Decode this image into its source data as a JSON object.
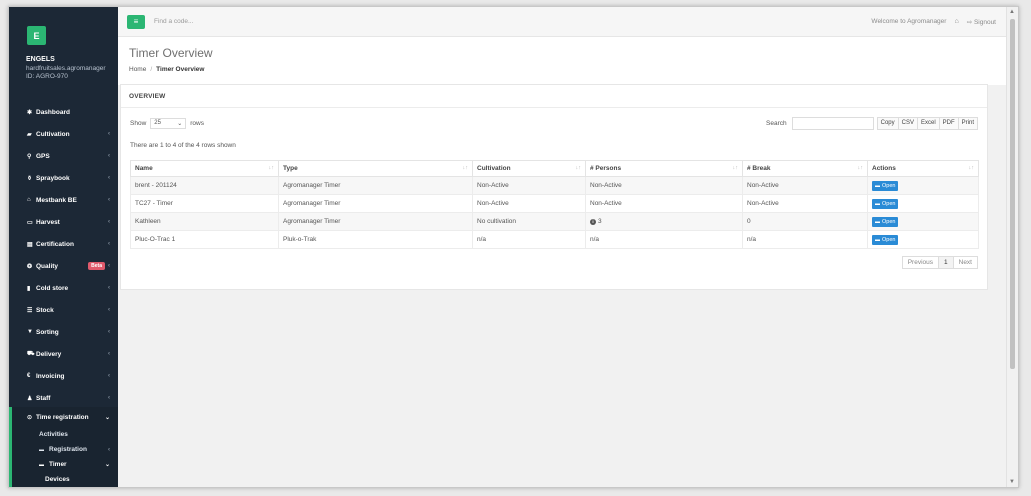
{
  "sidebar": {
    "logo_letter": "E",
    "company": "ENGELS",
    "account_host": "hardfruitsales.agromanager",
    "account_id": "ID: AGRO-970",
    "items": [
      {
        "label": "Dashboard",
        "icon": "✱",
        "chevron": ""
      },
      {
        "label": "Cultivation",
        "icon": "▰",
        "chevron": "‹"
      },
      {
        "label": "GPS",
        "icon": "⚲",
        "chevron": "‹"
      },
      {
        "label": "Spraybook",
        "icon": "⚱",
        "chevron": "‹"
      },
      {
        "label": "Mestbank BE",
        "icon": "⌂",
        "chevron": "‹"
      },
      {
        "label": "Harvest",
        "icon": "▭",
        "chevron": "‹"
      },
      {
        "label": "Certification",
        "icon": "▤",
        "chevron": "‹"
      },
      {
        "label": "Quality",
        "icon": "❂",
        "chevron": "‹",
        "badge": "Beta"
      },
      {
        "label": "Cold store",
        "icon": "▮",
        "chevron": "‹"
      },
      {
        "label": "Stock",
        "icon": "☰",
        "chevron": "‹"
      },
      {
        "label": "Sorting",
        "icon": "▼",
        "chevron": "‹"
      },
      {
        "label": "Delivery",
        "icon": "⛟",
        "chevron": "‹"
      },
      {
        "label": "Invoicing",
        "icon": "€",
        "chevron": "‹"
      },
      {
        "label": "Staff",
        "icon": "♟",
        "chevron": "‹"
      }
    ],
    "active_group": {
      "label": "Time registration",
      "icon": "⊙",
      "chevron": "⌄",
      "sub_items": [
        {
          "label": "Activities"
        },
        {
          "label": "Registration",
          "icon": "▬",
          "chevron": "‹"
        },
        {
          "label": "Timer",
          "icon": "▬",
          "chevron": "⌄"
        }
      ],
      "sub_sub_item": "Devices"
    }
  },
  "topbar": {
    "menu_icon": "≡",
    "search_placeholder": "Find a code...",
    "welcome": "Welcome to Agromanager",
    "home_icon": "⌂",
    "signout": "⇨ Signout"
  },
  "page": {
    "title": "Timer Overview",
    "breadcrumb_home": "Home",
    "breadcrumb_sep": "/",
    "breadcrumb_current": "Timer Overview"
  },
  "panel": {
    "heading": "OVERVIEW",
    "show_label": "Show",
    "page_size": "25",
    "rows_label": "rows",
    "search_label": "Search",
    "export_buttons": [
      "Copy",
      "CSV",
      "Excel",
      "PDF",
      "Print"
    ],
    "count_text": "There are 1 to 4 of the 4 rows shown",
    "columns": [
      "Name",
      "Type",
      "Cultivation",
      "# Persons",
      "# Break",
      "Actions"
    ],
    "sort_glyph": "↓↑",
    "rows": [
      {
        "name": "brent - 201124",
        "type": "Agromanager Timer",
        "cultivation": "Non-Active",
        "persons": "Non-Active",
        "persons_info": false,
        "break": "Non-Active",
        "action": "Open"
      },
      {
        "name": "TC27 - Timer",
        "type": "Agromanager Timer",
        "cultivation": "Non-Active",
        "persons": "Non-Active",
        "persons_info": false,
        "break": "Non-Active",
        "action": "Open"
      },
      {
        "name": "Kathleen",
        "type": "Agromanager Timer",
        "cultivation": "No cultivation",
        "persons": "3",
        "persons_info": true,
        "break": "0",
        "action": "Open"
      },
      {
        "name": "Pluc-O-Trac 1",
        "type": "Pluk-o-Trak",
        "cultivation": "n/a",
        "persons": "n/a",
        "persons_info": false,
        "break": "n/a",
        "action": "Open"
      }
    ],
    "pager": {
      "prev": "Previous",
      "current": "1",
      "next": "Next"
    }
  },
  "colors": {
    "accent": "#2bb673",
    "sidebar": "#1c2836",
    "button_blue": "#2a8bd6",
    "beta_badge": "#e05a6c"
  }
}
